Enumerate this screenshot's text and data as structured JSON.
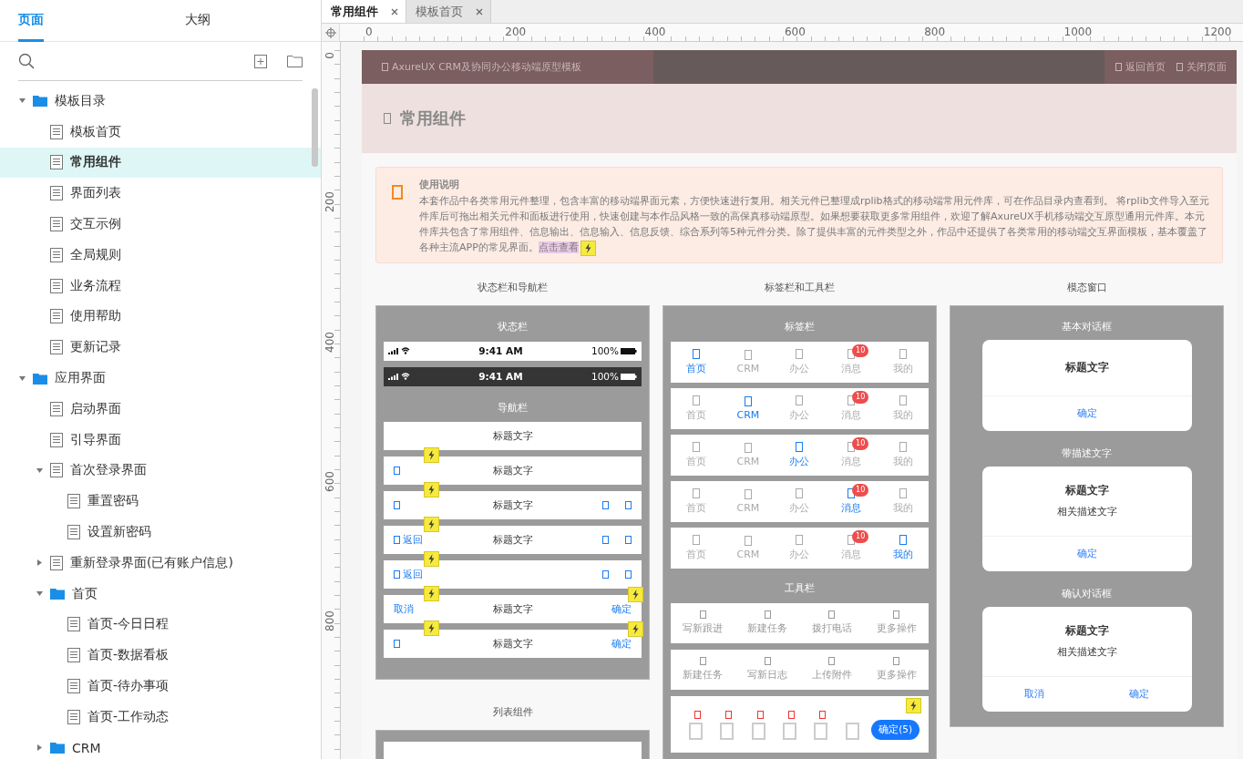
{
  "left_panel": {
    "tabs": [
      {
        "label": "页面",
        "selected": true
      },
      {
        "label": "大纲",
        "selected": false
      }
    ],
    "tree": [
      {
        "kind": "folder",
        "label": "模板目录",
        "expanded": true,
        "selected": false,
        "children": [
          {
            "kind": "page",
            "label": "模板首页",
            "selected": false
          },
          {
            "kind": "page",
            "label": "常用组件",
            "selected": true
          },
          {
            "kind": "page",
            "label": "界面列表",
            "selected": false
          },
          {
            "kind": "page",
            "label": "交互示例",
            "selected": false
          },
          {
            "kind": "page",
            "label": "全局规则",
            "selected": false
          },
          {
            "kind": "page",
            "label": "业务流程",
            "selected": false
          },
          {
            "kind": "page",
            "label": "使用帮助",
            "selected": false
          },
          {
            "kind": "page",
            "label": "更新记录",
            "selected": false
          }
        ]
      },
      {
        "kind": "folder",
        "label": "应用界面",
        "expanded": true,
        "selected": false,
        "children": [
          {
            "kind": "page",
            "label": "启动界面",
            "selected": false
          },
          {
            "kind": "page",
            "label": "引导界面",
            "selected": false
          },
          {
            "kind": "page",
            "label": "首次登录界面",
            "expanded": true,
            "selected": false,
            "children": [
              {
                "kind": "page",
                "label": "重置密码",
                "selected": false
              },
              {
                "kind": "page",
                "label": "设置新密码",
                "selected": false
              }
            ]
          },
          {
            "kind": "page",
            "label": "重新登录界面(已有账户信息)",
            "expanded": false,
            "selected": false
          },
          {
            "kind": "folder",
            "label": "首页",
            "expanded": true,
            "selected": false,
            "children": [
              {
                "kind": "page",
                "label": "首页-今日日程",
                "selected": false
              },
              {
                "kind": "page",
                "label": "首页-数据看板",
                "selected": false
              },
              {
                "kind": "page",
                "label": "首页-待办事项",
                "selected": false
              },
              {
                "kind": "page",
                "label": "首页-工作动态",
                "selected": false
              }
            ]
          },
          {
            "kind": "folder",
            "label": "CRM",
            "expanded": false,
            "selected": false
          }
        ]
      }
    ]
  },
  "doc_tabs": [
    {
      "label": "常用组件",
      "selected": true
    },
    {
      "label": "模板首页",
      "selected": false
    }
  ],
  "ruler": {
    "x_labels": [
      "0",
      "200",
      "400",
      "600",
      "800",
      "1000",
      "1200"
    ],
    "y_labels": [
      "0",
      "200",
      "400",
      "600",
      "800"
    ]
  },
  "page": {
    "header": {
      "title": "AxureUX CRM及协同办公移动端原型模板",
      "links": [
        "返回首页",
        "关闭页面"
      ]
    },
    "heading": "常用组件",
    "notice": {
      "title": "使用说明",
      "text": "本套作品中各类常用元件整理，包含丰富的移动端界面元素，方便快速进行复用。相关元件已整理成rplib格式的移动端常用元件库，可在作品目录内查看到。 将rplib文件导入至元件库后可拖出相关元件和面板进行使用，快速创建与本作品风格一致的高保真移动端原型。如果想要获取更多常用组件，欢迎了解AxureUX手机移动端交互原型通用元件库。本元件库共包含了常用组件、信息输出、信息输入、信息反馈、综合系列等5种元件分类。除了提供丰富的元件类型之外，作品中还提供了各类常用的移动端交互界面模板，基本覆盖了各种主流APP的常见界面。",
      "link": "点击查看",
      "link_interaction": true
    },
    "status_nav": {
      "title": "状态栏和导航栏",
      "status_label": "状态栏",
      "status_bars": [
        {
          "dark": false,
          "time": "9:41 AM",
          "battery": "100%"
        },
        {
          "dark": true,
          "time": "9:41 AM",
          "battery": "100%"
        }
      ],
      "nav_label": "导航栏",
      "nav_bars": [
        {
          "left": {
            "kind": "none"
          },
          "title": "标题文字",
          "right": {
            "kind": "none"
          },
          "interaction": false,
          "interaction_right": false
        },
        {
          "left": {
            "kind": "icon"
          },
          "title": "标题文字",
          "right": {
            "kind": "none"
          },
          "interaction": true,
          "interaction_right": false
        },
        {
          "left": {
            "kind": "icon"
          },
          "title": "标题文字",
          "right": {
            "kind": "icons"
          },
          "interaction": true,
          "interaction_right": false
        },
        {
          "left": {
            "kind": "icon-text",
            "text": "返回"
          },
          "title": "标题文字",
          "right": {
            "kind": "icons"
          },
          "interaction": true,
          "interaction_right": false
        },
        {
          "left": {
            "kind": "icon-text",
            "text": "返回"
          },
          "right": {
            "kind": "icons"
          },
          "interaction": true,
          "interaction_right": false
        },
        {
          "left": {
            "kind": "text",
            "text": "取消"
          },
          "title": "标题文字",
          "right": {
            "kind": "text",
            "text": "确定"
          },
          "interaction": true,
          "interaction_right": true
        },
        {
          "left": {
            "kind": "icon"
          },
          "title": "标题文字",
          "right": {
            "kind": "text",
            "text": "确定"
          },
          "interaction": true,
          "interaction_right": true
        }
      ]
    },
    "list_section": {
      "title": "列表组件"
    },
    "tab_tool": {
      "title": "标签栏和工具栏",
      "tabbar_label": "标签栏",
      "tabbars": [
        {
          "items": [
            {
              "label": "首页",
              "selected": true
            },
            {
              "label": "CRM",
              "selected": false
            },
            {
              "label": "办公",
              "selected": false
            },
            {
              "label": "消息",
              "selected": false,
              "badge": "10"
            },
            {
              "label": "我的",
              "selected": false
            }
          ]
        },
        {
          "items": [
            {
              "label": "首页",
              "selected": false
            },
            {
              "label": "CRM",
              "selected": true
            },
            {
              "label": "办公",
              "selected": false
            },
            {
              "label": "消息",
              "selected": false,
              "badge": "10"
            },
            {
              "label": "我的",
              "selected": false
            }
          ]
        },
        {
          "items": [
            {
              "label": "首页",
              "selected": false
            },
            {
              "label": "CRM",
              "selected": false
            },
            {
              "label": "办公",
              "selected": true
            },
            {
              "label": "消息",
              "selected": false,
              "badge": "10"
            },
            {
              "label": "我的",
              "selected": false
            }
          ]
        },
        {
          "items": [
            {
              "label": "首页",
              "selected": false
            },
            {
              "label": "CRM",
              "selected": false
            },
            {
              "label": "办公",
              "selected": false
            },
            {
              "label": "消息",
              "selected": true,
              "badge": "10"
            },
            {
              "label": "我的",
              "selected": false
            }
          ]
        },
        {
          "items": [
            {
              "label": "首页",
              "selected": false
            },
            {
              "label": "CRM",
              "selected": false
            },
            {
              "label": "办公",
              "selected": false
            },
            {
              "label": "消息",
              "selected": false,
              "badge": "10"
            },
            {
              "label": "我的",
              "selected": true
            }
          ]
        }
      ],
      "toolbar_label": "工具栏",
      "toolbars": [
        {
          "kind": "labeled",
          "items": [
            "写新跟进",
            "新建任务",
            "拨打电话",
            "更多操作"
          ]
        },
        {
          "kind": "labeled",
          "items": [
            "新建任务",
            "写新日志",
            "上传附件",
            "更多操作"
          ]
        },
        {
          "kind": "select",
          "icons": [
            {
              "flagged": true
            },
            {
              "flagged": true
            },
            {
              "flagged": true
            },
            {
              "flagged": true
            },
            {
              "flagged": true
            },
            {
              "flagged": false
            }
          ],
          "button": "确定(5)",
          "interaction": true
        }
      ]
    },
    "modal": {
      "title": "模态窗口",
      "dialogs": [
        {
          "label": "基本对话框",
          "title": "标题文字",
          "buttons": [
            "确定"
          ]
        },
        {
          "label": "带描述文字",
          "title": "标题文字",
          "desc": "相关描述文字",
          "buttons": [
            "确定"
          ]
        },
        {
          "label": "确认对话框",
          "title": "标题文字",
          "desc": "相关描述文字",
          "buttons": [
            "取消",
            "确定"
          ]
        }
      ]
    }
  }
}
